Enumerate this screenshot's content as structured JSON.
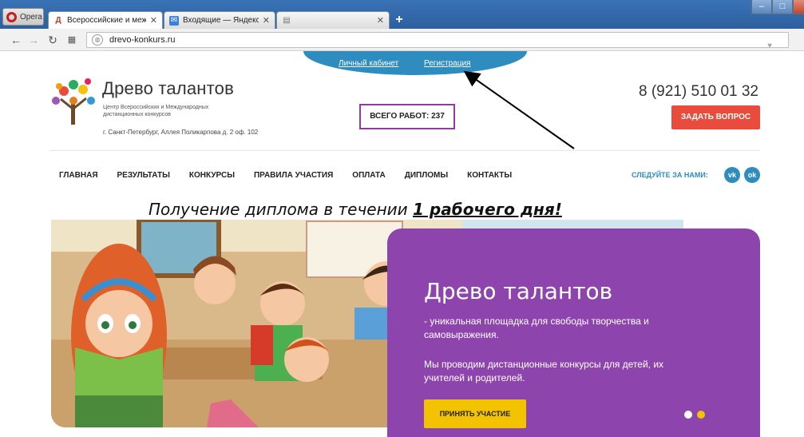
{
  "browser": {
    "opera_label": "Opera",
    "tabs": [
      {
        "title": "Всероссийские и междун",
        "close": "✕"
      },
      {
        "title": "Входящие — Яндекс.Поч",
        "close": "✕"
      },
      {
        "title": "",
        "close": "✕"
      }
    ],
    "new_tab": "+",
    "url": "drevo-konkurs.ru"
  },
  "top_links": {
    "cabinet": "Личный кабинет",
    "register": "Регистрация"
  },
  "header": {
    "brand": "Древо талантов",
    "subtitle": "Центр Всероссийских и Международных дистанционных конкурсов",
    "address": "г. Санкт-Петербург, Аллея Поликарпова д. 2 оф. 102",
    "counter": "ВСЕГО РАБОТ: 237",
    "phone": "8 (921) 510 01 32",
    "ask_button": "ЗАДАТЬ ВОПРОС"
  },
  "nav": {
    "items": [
      "ГЛАВНАЯ",
      "РЕЗУЛЬТАТЫ",
      "КОНКУРСЫ",
      "ПРАВИЛА УЧАСТИЯ",
      "ОПЛАТА",
      "ДИПЛОМЫ",
      "КОНТАКТЫ"
    ],
    "follow": "СЛЕДУЙТЕ ЗА НАМИ:",
    "social": [
      {
        "label": "vk",
        "icon": "vk-icon"
      },
      {
        "label": "ok",
        "icon": "odnoklassniki-icon"
      }
    ]
  },
  "promo": {
    "text": "Получение диплома в течении",
    "highlight": "1 рабочего дня!"
  },
  "card": {
    "title": "Древо талантов",
    "desc1": "- уникальная площадка для свободы творчества и самовыражения.",
    "desc2": "Мы проводим дистанционные конкурсы для детей, их учителей и родителей.",
    "button": "ПРИНЯТЬ УЧАСТИЕ"
  },
  "colors": {
    "accent_blue": "#2e8cbf",
    "accent_red": "#e94b3c",
    "card_purple": "#8e44ad",
    "button_yellow": "#f3c200",
    "counter_border": "#8b3f98"
  }
}
